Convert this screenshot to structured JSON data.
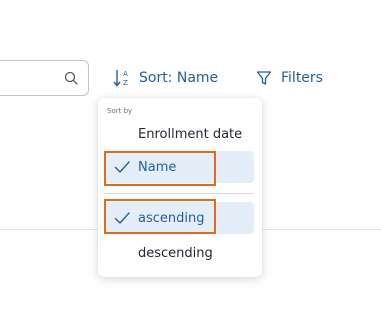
{
  "toolbar": {
    "search": {
      "value": "",
      "placeholder": ""
    },
    "sort_button_label": "Sort: Name",
    "filters_button_label": "Filters"
  },
  "sort_menu": {
    "header": "Sort by",
    "field_options": [
      {
        "label": "Enrollment date",
        "selected": false
      },
      {
        "label": "Name",
        "selected": true
      }
    ],
    "direction_options": [
      {
        "label": "ascending",
        "selected": true
      },
      {
        "label": "descending",
        "selected": false
      }
    ]
  },
  "colors": {
    "accent": "#1f5f9e",
    "selected_background": "#e4eef8",
    "highlight_outline": "#e26b1b"
  }
}
